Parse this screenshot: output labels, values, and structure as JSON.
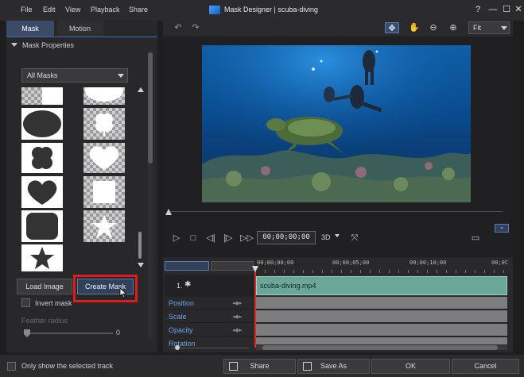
{
  "window": {
    "title": "Mask Designer  |  scuba-diving",
    "menu": [
      "File",
      "Edit",
      "View",
      "Playback",
      "Share"
    ],
    "controls": {
      "help": "?",
      "minimize": "—",
      "maximize": "☐",
      "close": "✕"
    }
  },
  "left_panel": {
    "tabs": [
      {
        "label": "Mask",
        "active": true
      },
      {
        "label": "Motion",
        "active": false
      }
    ],
    "section_title": "Mask Properties",
    "filter": {
      "selected": "All Masks"
    },
    "mask_shapes": [
      "square",
      "rounded-rect",
      "oval",
      "clover",
      "flower",
      "heart",
      "heart",
      "square",
      "rounded-square",
      "star",
      "star"
    ],
    "load_image_label": "Load Image",
    "create_mask_label": "Create Mask",
    "invert_mask_label": "Invert mask",
    "feather_radius_label": "Feather radius",
    "feather_radius_value": "0"
  },
  "preview": {
    "fit_label": "Fit",
    "timecode": "00;00;00;00",
    "view_mode": "3D"
  },
  "timeline": {
    "ruler_labels": [
      "00;00;00;00",
      "00;00;05;00",
      "00;00;10;00",
      "00;0C"
    ],
    "track_number": "1.",
    "clip_name": "scuba-diving.mp4",
    "properties": [
      "Position",
      "Scale",
      "Opacity",
      "Rotation"
    ]
  },
  "footer": {
    "only_selected_label": "Only show the selected track",
    "share_label": "Share",
    "save_as_label": "Save As",
    "ok_label": "OK",
    "cancel_label": "Cancel"
  },
  "colors": {
    "accent": "#3b4a66",
    "highlight_box": "#e11b1b",
    "clip": "#6aa799",
    "property_label": "#6ea2e8"
  }
}
